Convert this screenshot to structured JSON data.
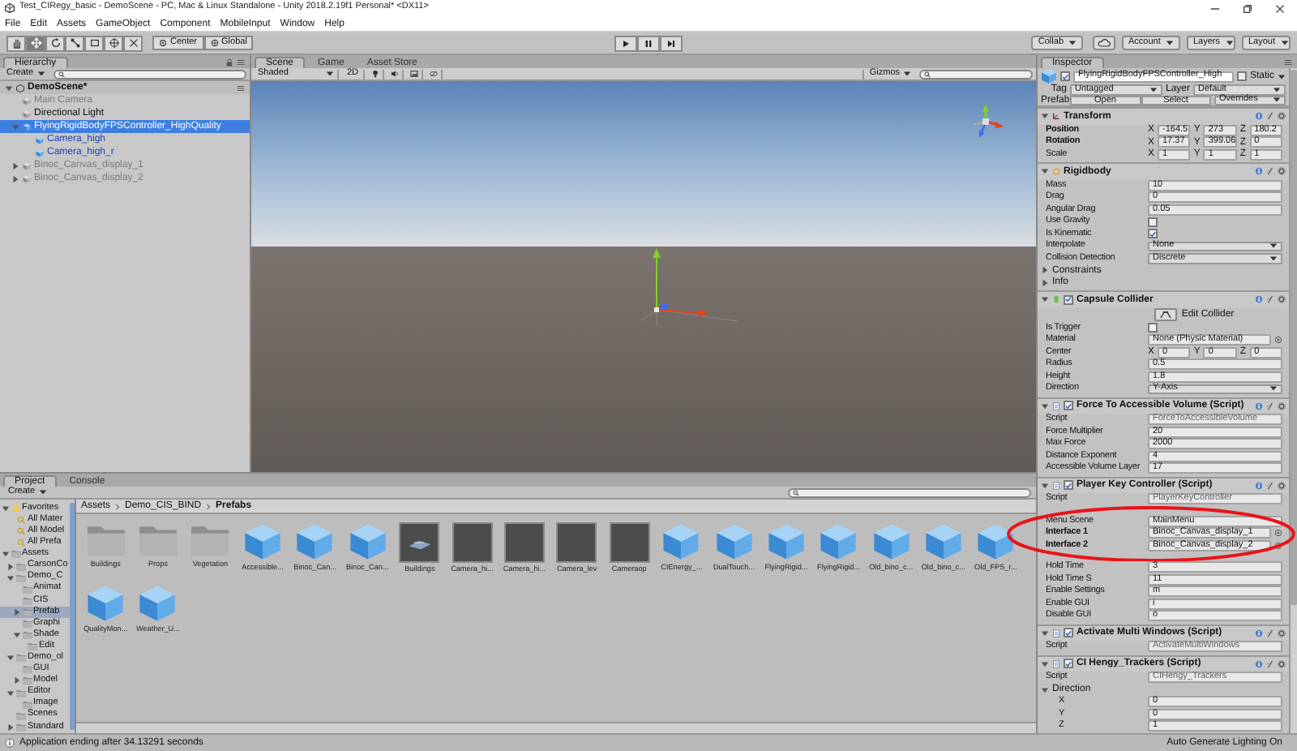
{
  "window": {
    "title": "Test_CIRegy_basic - DemoScene - PC, Mac & Linux Standalone - Unity 2018.2.19f1 Personal* <DX11>"
  },
  "menu": [
    "File",
    "Edit",
    "Assets",
    "GameObject",
    "Component",
    "MobileInput",
    "Window",
    "Help"
  ],
  "toolbar": {
    "tools": [
      {
        "kind": "hand",
        "selected": false
      },
      {
        "kind": "move",
        "selected": true
      },
      {
        "kind": "rotate",
        "selected": false
      },
      {
        "kind": "scale",
        "selected": false
      },
      {
        "kind": "rect",
        "selected": false
      },
      {
        "kind": "transform",
        "selected": false
      },
      {
        "kind": "custom",
        "selected": false
      }
    ],
    "pivot": "Center",
    "space": "Global",
    "collab": "Collab",
    "account": "Account",
    "layers": "Layers",
    "layout": "Layout"
  },
  "hierarchy": {
    "tab": "Hierarchy",
    "create": "Create",
    "scene": "DemoScene*",
    "items": [
      {
        "label": "Main Camera",
        "selected": false,
        "prefab": false,
        "active": false
      },
      {
        "label": "Directional Light",
        "selected": false,
        "prefab": false,
        "active": true
      },
      {
        "label": "FlyingRigidBodyFPSController_HighQuality",
        "selected": true,
        "prefab": true,
        "active": true,
        "expanded": true,
        "children": [
          {
            "label": "Camera_high",
            "selected": false,
            "prefab": true,
            "active": true
          },
          {
            "label": "Camera_high_r",
            "selected": false,
            "prefab": true,
            "active": true
          }
        ]
      },
      {
        "label": "Binoc_Canvas_display_1",
        "selected": false,
        "prefab": false,
        "active": false,
        "expanded": false
      },
      {
        "label": "Binoc_Canvas_display_2",
        "selected": false,
        "prefab": false,
        "active": false,
        "expanded": false
      }
    ]
  },
  "scene": {
    "tabs": [
      {
        "label": "Scene",
        "selected": true
      },
      {
        "label": "Game",
        "selected": false
      },
      {
        "label": "Asset Store",
        "selected": false
      }
    ],
    "shading": "Shaded",
    "mode_2d": "2D",
    "gizmos": "Gizmos"
  },
  "inspector": {
    "tab": "Inspector",
    "object": {
      "active": true,
      "name": "FlyingRigidBodyFPSController_High",
      "static": false,
      "static_label": "Static"
    },
    "tag_label": "Tag",
    "tag": "Untagged",
    "layer_label": "Layer",
    "layer": "Default",
    "prefab_label": "Prefab",
    "prefab_buttons": [
      "Open",
      "Select"
    ],
    "overrides": "Overrides",
    "components": [
      {
        "title": "Transform",
        "kind": "transform",
        "rows": [
          {
            "kind": "vector",
            "label": "Position",
            "bold": true,
            "values": [
              {
                "axis": "X",
                "value": "-164.5"
              },
              {
                "axis": "Y",
                "value": "273"
              },
              {
                "axis": "Z",
                "value": "180.2"
              }
            ]
          },
          {
            "kind": "vector",
            "label": "Rotation",
            "bold": true,
            "values": [
              {
                "axis": "X",
                "value": "17.37"
              },
              {
                "axis": "Y",
                "value": "399.06"
              },
              {
                "axis": "Z",
                "value": "0"
              }
            ]
          },
          {
            "kind": "vector",
            "label": "Scale",
            "values": [
              {
                "axis": "X",
                "value": "1"
              },
              {
                "axis": "Y",
                "value": "1"
              },
              {
                "axis": "Z",
                "value": "1"
              }
            ]
          }
        ]
      },
      {
        "title": "Rigidbody",
        "kind": "rigidbody",
        "rows": [
          {
            "kind": "field",
            "label": "Mass",
            "value": "10"
          },
          {
            "kind": "field",
            "label": "Drag",
            "value": "0"
          },
          {
            "kind": "field",
            "label": "Angular Drag",
            "value": "0.05"
          },
          {
            "kind": "checkbox",
            "label": "Use Gravity",
            "checked": false
          },
          {
            "kind": "checkbox",
            "label": "Is Kinematic",
            "checked": true
          },
          {
            "kind": "dropdown",
            "label": "Interpolate",
            "value": "None"
          },
          {
            "kind": "dropdown",
            "label": "Collision Detection",
            "value": "Discrete"
          },
          {
            "kind": "foldout",
            "label": "Constraints",
            "expanded": false
          },
          {
            "kind": "foldout",
            "label": "Info",
            "expanded": false
          }
        ]
      },
      {
        "title": "Capsule Collider",
        "kind": "collider",
        "enabled": true,
        "rows": [
          {
            "kind": "button",
            "label": "Edit Collider"
          },
          {
            "kind": "checkbox",
            "label": "Is Trigger",
            "checked": false
          },
          {
            "kind": "object",
            "label": "Material",
            "value": "None (Physic Material)"
          },
          {
            "kind": "vector",
            "label": "Center",
            "values": [
              {
                "axis": "X",
                "value": "0"
              },
              {
                "axis": "Y",
                "value": "0"
              },
              {
                "axis": "Z",
                "value": "0"
              }
            ]
          },
          {
            "kind": "field",
            "label": "Radius",
            "value": "0.5"
          },
          {
            "kind": "field",
            "label": "Height",
            "value": "1.8"
          },
          {
            "kind": "dropdown",
            "label": "Direction",
            "value": "Y-Axis"
          }
        ]
      },
      {
        "title": "Force To Accessible Volume (Script)",
        "kind": "script",
        "enabled": true,
        "rows": [
          {
            "kind": "script",
            "label": "Script",
            "value": "ForceToAccessibleVolume"
          },
          {
            "kind": "field",
            "label": "Force Multiplier",
            "value": "20"
          },
          {
            "kind": "field",
            "label": "Max Force",
            "value": "2000"
          },
          {
            "kind": "field",
            "label": "Distance Exponent",
            "value": "4"
          },
          {
            "kind": "field",
            "label": "Accessible Volume Layer",
            "value": "17"
          }
        ]
      },
      {
        "title": "Player Key Controller (Script)",
        "kind": "script",
        "enabled": true,
        "rows": [
          {
            "kind": "script",
            "label": "Script",
            "value": "PlayerKeyController"
          },
          {
            "kind": "field",
            "label": "Menu Scene",
            "value": "MainMenu",
            "circled": true
          },
          {
            "kind": "object",
            "label": "Interface 1",
            "bold": true,
            "value": "Binoc_Canvas_display_1",
            "circled": true
          },
          {
            "kind": "object",
            "label": "Interface 2",
            "bold": true,
            "value": "Binoc_Canvas_display_2",
            "circled": true
          },
          {
            "kind": "field",
            "label": "Hold Time",
            "value": "3"
          },
          {
            "kind": "field",
            "label": "Hold Time S",
            "value": "11"
          },
          {
            "kind": "field",
            "label": "Enable Settings",
            "value": "m"
          },
          {
            "kind": "field",
            "label": "Enable GUI",
            "value": "i"
          },
          {
            "kind": "field",
            "label": "Disable GUI",
            "value": "o"
          }
        ]
      },
      {
        "title": "Activate Multi Windows (Script)",
        "kind": "script",
        "enabled": true,
        "rows": [
          {
            "kind": "script",
            "label": "Script",
            "value": "ActivateMultiWindows"
          }
        ]
      },
      {
        "title": "CI Hengy_Trackers (Script)",
        "kind": "script",
        "enabled": true,
        "rows": [
          {
            "kind": "script",
            "label": "Script",
            "value": "CIHengy_Trackers"
          },
          {
            "kind": "foldout",
            "label": "Direction",
            "expanded": true,
            "children": [
              {
                "kind": "field",
                "label": "X",
                "value": "0"
              },
              {
                "kind": "field",
                "label": "Y",
                "value": "0"
              },
              {
                "kind": "field",
                "label": "Z",
                "value": "1"
              }
            ]
          }
        ]
      }
    ]
  },
  "project": {
    "tabs": [
      {
        "label": "Project",
        "selected": true
      },
      {
        "label": "Console",
        "selected": false
      }
    ],
    "create": "Create",
    "tree": [
      {
        "label": "Favorites",
        "kind": "favorites",
        "selected": false,
        "expanded": true,
        "children": [
          {
            "label": "All Mater",
            "kind": "search",
            "selected": false
          },
          {
            "label": "All Model",
            "kind": "search",
            "selected": false
          },
          {
            "label": "All Prefa",
            "kind": "search",
            "selected": false
          }
        ]
      },
      {
        "label": "Assets",
        "kind": "folder",
        "selected": false,
        "expanded": true,
        "children": [
          {
            "label": "CarsonCo",
            "kind": "folder",
            "selected": false,
            "expanded": false
          },
          {
            "label": "Demo_C",
            "kind": "folder",
            "selected": false,
            "expanded": true,
            "children": [
              {
                "label": "Animat",
                "kind": "folder",
                "selected": false
              },
              {
                "label": "CIS",
                "kind": "folder",
                "selected": false
              },
              {
                "label": "Prefab",
                "kind": "folder",
                "selected": true,
                "expanded": false
              },
              {
                "label": "Graphi",
                "kind": "folder",
                "selected": false
              },
              {
                "label": "Shade",
                "kind": "folder",
                "selected": false,
                "expanded": true,
                "children": [
                  {
                    "label": "Edit",
                    "kind": "folder",
                    "selected": false
                  }
                ]
              }
            ]
          },
          {
            "label": "Demo_ol",
            "kind": "folder",
            "selected": false,
            "expanded": true,
            "children": [
              {
                "label": "GUI",
                "kind": "folder",
                "selected": false
              },
              {
                "label": "Model",
                "kind": "folder",
                "selected": false,
                "expanded": false
              }
            ]
          },
          {
            "label": "Editor",
            "kind": "folder",
            "selected": false,
            "expanded": true,
            "children": [
              {
                "label": "Image",
                "kind": "folder",
                "selected": false
              }
            ]
          },
          {
            "label": "Scenes",
            "kind": "folder",
            "selected": false
          },
          {
            "label": "Standard",
            "kind": "folder",
            "selected": false,
            "expanded": false
          }
        ]
      }
    ],
    "breadcrumb": [
      "Assets",
      "Demo_CIS_BIND",
      "Prefabs"
    ],
    "items": [
      {
        "label": "Buildings",
        "kind": "folder"
      },
      {
        "label": "Props",
        "kind": "folder"
      },
      {
        "label": "Vegetation",
        "kind": "folder"
      },
      {
        "label": "Accessible...",
        "kind": "prefab"
      },
      {
        "label": "Binoc_Can...",
        "kind": "prefab"
      },
      {
        "label": "Binoc_Can...",
        "kind": "prefab"
      },
      {
        "label": "Buildings",
        "kind": "model"
      },
      {
        "label": "Camera_hi...",
        "kind": "thumb"
      },
      {
        "label": "Camera_hi...",
        "kind": "thumb"
      },
      {
        "label": "Camera_lev",
        "kind": "thumb"
      },
      {
        "label": "Cameraop",
        "kind": "thumb"
      },
      {
        "label": "CIEnergy_...",
        "kind": "prefab"
      },
      {
        "label": "DualTouch...",
        "kind": "prefab"
      },
      {
        "label": "FlyingRigid...",
        "kind": "prefab"
      },
      {
        "label": "FlyingRigid...",
        "kind": "prefab"
      },
      {
        "label": "Old_bino_c...",
        "kind": "prefab"
      },
      {
        "label": "Old_bino_c...",
        "kind": "prefab"
      },
      {
        "label": "Old_FPS_r...",
        "kind": "prefab"
      },
      {
        "label": "QualityMon...",
        "kind": "prefab"
      },
      {
        "label": "Weather_U...",
        "kind": "prefab"
      }
    ]
  },
  "status_bar": {
    "message": "Application ending after 34.13291 seconds",
    "lighting": "Auto Generate Lighting On"
  }
}
